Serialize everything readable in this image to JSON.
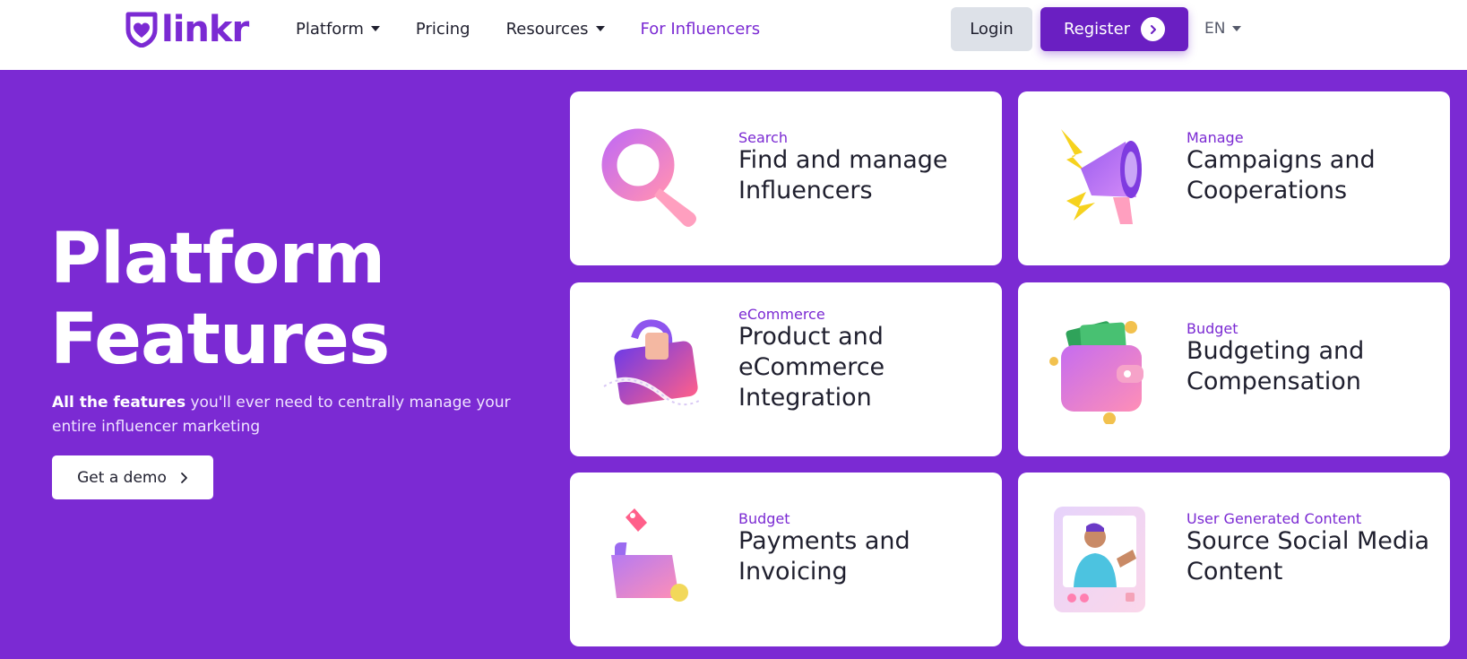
{
  "header": {
    "logo_text": "linkr",
    "nav": [
      {
        "label": "Platform",
        "has_dropdown": true
      },
      {
        "label": "Pricing",
        "has_dropdown": false
      },
      {
        "label": "Resources",
        "has_dropdown": true
      },
      {
        "label": "For Influencers",
        "has_dropdown": false
      }
    ],
    "login_label": "Login",
    "register_label": "Register",
    "language": "EN"
  },
  "hero": {
    "title_line1": "Platform",
    "title_line2": "Features",
    "desc_bold": "All the features",
    "desc_rest": " you'll ever need to centrally manage your entire influencer marketing",
    "demo_label": "Get a demo"
  },
  "cards": [
    {
      "category": "Search",
      "title": "Find and manage Influencers",
      "icon": "magnifier-icon"
    },
    {
      "category": "Manage",
      "title": "Campaigns and Cooperations",
      "icon": "megaphone-icon"
    },
    {
      "category": "eCommerce",
      "title": "Product and eCommerce Integration",
      "icon": "shopping-bag-icon"
    },
    {
      "category": "Budget",
      "title": "Budgeting and Compensation",
      "icon": "wallet-icon"
    },
    {
      "category": "Budget",
      "title": "Payments and Invoicing",
      "icon": "folder-icon"
    },
    {
      "category": "User Generated Content",
      "title": "Source Social Media Content",
      "icon": "photo-frame-icon"
    }
  ],
  "colors": {
    "brand": "#7b2ad3",
    "register": "#6a1fc2",
    "text": "#1f1f2e",
    "login_bg": "#dde1e8"
  }
}
